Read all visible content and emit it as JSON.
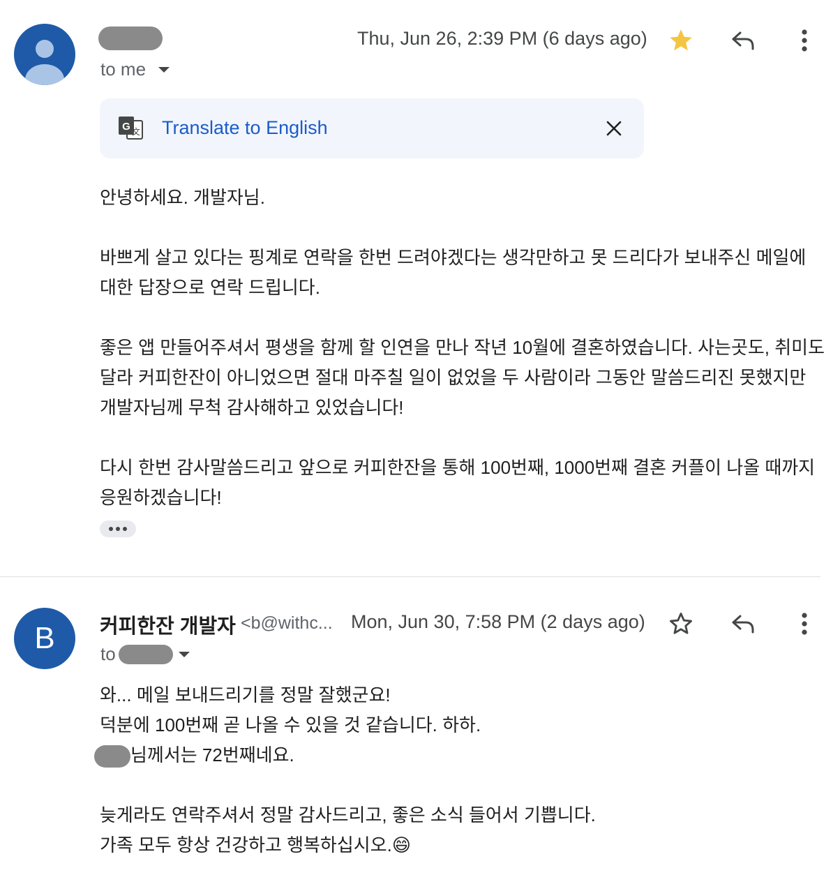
{
  "message1": {
    "to_label": "to me",
    "timestamp": "Thu, Jun 26, 2:39 PM (6 days ago)",
    "starred": true,
    "translate_label": "Translate to English",
    "body": [
      "안녕하세요. 개발자님.",
      "바쁘게 살고 있다는 핑계로 연락을 한번 드려야겠다는 생각만하고 못 드리다가 보내주신 메일에 대한 답장으로 연락 드립니다.",
      "좋은 앱 만들어주셔서 평생을 함께 할 인연을 만나 작년 10월에 결혼하였습니다. 사는곳도, 취미도 달라 커피한잔이 아니었으면 절대 마주칠 일이 없었을 두 사람이라 그동안 말씀드리진 못했지만 개발자님께 무척 감사해하고 있었습니다!",
      "다시 한번 감사말씀드리고 앞으로 커피한잔을 통해 100번째, 1000번째 결혼 커플이 나올 때까지 응원하겠습니다!"
    ]
  },
  "message2": {
    "avatar_letter": "B",
    "sender_name": "커피한잔 개발자",
    "sender_email": "<b@withc...",
    "to_label": "to",
    "timestamp": "Mon, Jun 30, 7:58 PM (2 days ago)",
    "starred": false,
    "body": {
      "line1": "와... 메일 보내드리기를 정말 잘했군요!",
      "line2": "덕분에 100번째 곧 나올 수 있을 것 같습니다. 하하.",
      "line3_suffix": "님께서는 72번째네요.",
      "line4": "늦게라도 연락주셔서 정말 감사드리고, 좋은 소식 들어서 기쁩니다.",
      "line5": "가족 모두 항상 건강하고 행복하십시오.",
      "emoji": "😄"
    }
  },
  "colors": {
    "avatar": "#1e5aa8",
    "link": "#1a5cc8",
    "star_filled": "#f4c542",
    "translate_bg": "#f2f5fc"
  }
}
